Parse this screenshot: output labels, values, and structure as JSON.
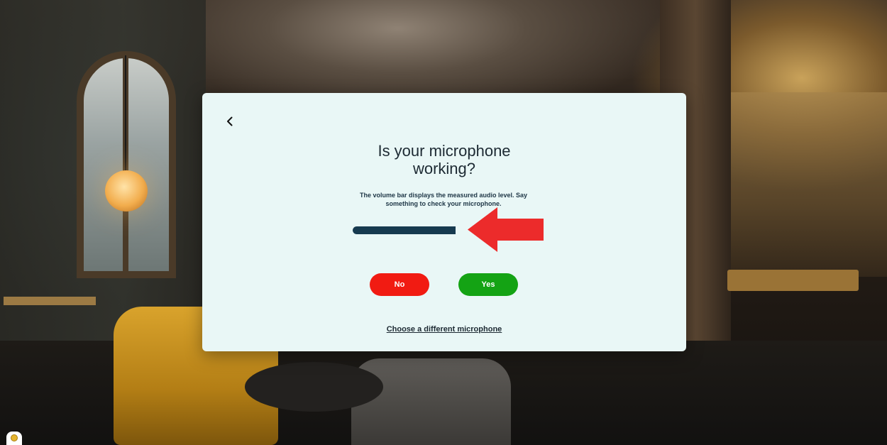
{
  "dialog": {
    "title_line1": "Is your microphone",
    "title_line2": "working?",
    "description": "The volume bar displays the measured audio level. Say something to check your microphone.",
    "volume_level": 1.0,
    "no_label": "No",
    "yes_label": "Yes",
    "change_microphone_label": "Choose a different microphone"
  },
  "icons": {
    "back": "chevron-left-icon",
    "annotation": "red-arrow-left-icon",
    "help": "help-badge-icon"
  },
  "colors": {
    "modal_bg": "#e9f7f6",
    "no_button": "#f11b12",
    "yes_button": "#14a314",
    "volume_fill": "#163a4f",
    "annotation_arrow": "#ec2b2b"
  }
}
